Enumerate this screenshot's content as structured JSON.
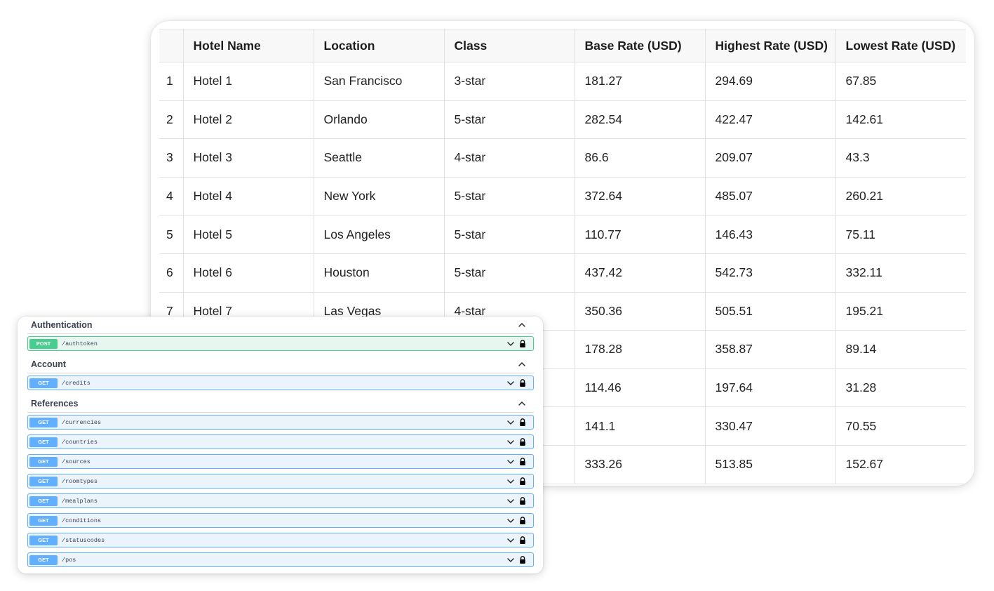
{
  "table": {
    "columns": [
      "",
      "Hotel Name",
      "Location",
      "Class",
      "Base Rate (USD)",
      "Highest Rate (USD)",
      "Lowest Rate (USD)"
    ],
    "rows": [
      [
        "1",
        "Hotel 1",
        "San Francisco",
        "3-star",
        "181.27",
        "294.69",
        "67.85"
      ],
      [
        "2",
        "Hotel 2",
        "Orlando",
        "5-star",
        "282.54",
        "422.47",
        "142.61"
      ],
      [
        "3",
        "Hotel 3",
        "Seattle",
        "4-star",
        "86.6",
        "209.07",
        "43.3"
      ],
      [
        "4",
        "Hotel 4",
        "New York",
        "5-star",
        "372.64",
        "485.07",
        "260.21"
      ],
      [
        "5",
        "Hotel 5",
        "Los Angeles",
        "5-star",
        "110.77",
        "146.43",
        "75.11"
      ],
      [
        "6",
        "Hotel 6",
        "Houston",
        "5-star",
        "437.42",
        "542.73",
        "332.11"
      ],
      [
        "7",
        "Hotel 7",
        "Las Vegas",
        "4-star",
        "350.36",
        "505.51",
        "195.21"
      ],
      [
        "",
        "",
        "",
        "",
        "178.28",
        "358.87",
        "89.14"
      ],
      [
        "",
        "",
        "",
        "",
        "114.46",
        "197.64",
        "31.28"
      ],
      [
        "",
        "",
        "",
        "",
        "141.1",
        "330.47",
        "70.55"
      ],
      [
        "",
        "",
        "",
        "",
        "333.26",
        "513.85",
        "152.67"
      ]
    ]
  },
  "api": {
    "sections": [
      {
        "title": "Authentication",
        "operations": [
          {
            "method": "POST",
            "path": "/authtoken"
          }
        ]
      },
      {
        "title": "Account",
        "operations": [
          {
            "method": "GET",
            "path": "/credits"
          }
        ]
      },
      {
        "title": "References",
        "operations": [
          {
            "method": "GET",
            "path": "/currencies"
          },
          {
            "method": "GET",
            "path": "/countries"
          },
          {
            "method": "GET",
            "path": "/sources"
          },
          {
            "method": "GET",
            "path": "/roomtypes"
          },
          {
            "method": "GET",
            "path": "/mealplans"
          },
          {
            "method": "GET",
            "path": "/conditions"
          },
          {
            "method": "GET",
            "path": "/statuscodes"
          },
          {
            "method": "GET",
            "path": "/pos"
          }
        ]
      }
    ]
  },
  "icons": {
    "collapse": "chevron-up-icon",
    "expand": "chevron-down-icon",
    "lock": "lock-icon"
  },
  "colors": {
    "get": "#61affe",
    "post": "#49cc90"
  }
}
